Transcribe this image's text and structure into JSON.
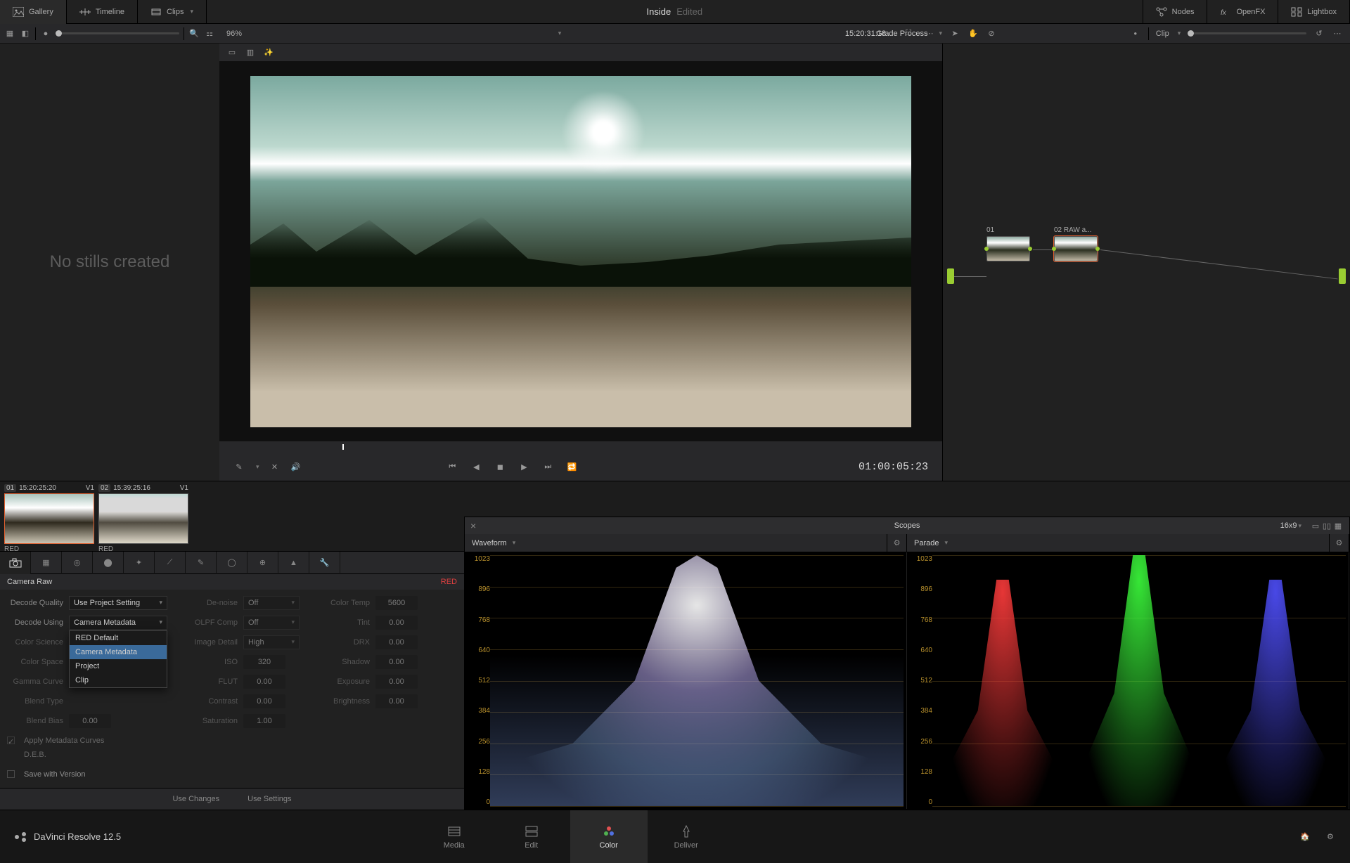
{
  "topbar": {
    "gallery": "Gallery",
    "timeline": "Timeline",
    "clips": "Clips",
    "title": "Inside",
    "subtitle": "Edited",
    "nodes": "Nodes",
    "openfx": "OpenFX",
    "lightbox": "Lightbox"
  },
  "toolbar2": {
    "zoom": "96%",
    "title": "Grade Process",
    "timecode": "15:20:31:18",
    "clip": "Clip"
  },
  "gallery": {
    "empty": "No stills created"
  },
  "viewer": {
    "timecode": "01:00:05:23"
  },
  "nodes": {
    "n1": "01",
    "n2": "02  RAW a..."
  },
  "clips": [
    {
      "num": "01",
      "tc": "15:20:25:20",
      "track": "V1",
      "codec": "RED"
    },
    {
      "num": "02",
      "tc": "15:39:25:16",
      "track": "V1",
      "codec": "RED"
    }
  ],
  "raw": {
    "title": "Camera Raw",
    "brand": "RED",
    "decodeQualityLabel": "Decode Quality",
    "decodeQuality": "Use Project Setting",
    "decodeUsingLabel": "Decode Using",
    "decodeUsing": "Camera Metadata",
    "dropdown": [
      "RED Default",
      "Camera Metadata",
      "Project",
      "Clip"
    ],
    "colorScienceLabel": "Color Science",
    "colorSpaceLabel": "Color Space",
    "gammaCurveLabel": "Gamma Curve",
    "blendTypeLabel": "Blend Type",
    "blendBiasLabel": "Blend Bias",
    "blendBias": "0.00",
    "applyMetaCurves": "Apply Metadata Curves",
    "deb": "D.E.B.",
    "saveVersion": "Save with Version",
    "denoiseLabel": "De-noise",
    "denoise": "Off",
    "olpfLabel": "OLPF Comp",
    "olpf": "Off",
    "imageDetailLabel": "Image Detail",
    "imageDetail": "High",
    "isoLabel": "ISO",
    "iso": "320",
    "flutLabel": "FLUT",
    "flut": "0.00",
    "contrastLabel": "Contrast",
    "contrast": "0.00",
    "saturationLabel": "Saturation",
    "saturation": "1.00",
    "colorTempLabel": "Color Temp",
    "colorTemp": "5600",
    "tintLabel": "Tint",
    "tint": "0.00",
    "drxLabel": "DRX",
    "drx": "0.00",
    "shadowLabel": "Shadow",
    "shadow": "0.00",
    "exposureLabel": "Exposure",
    "exposure": "0.00",
    "brightnessLabel": "Brightness",
    "brightness": "0.00",
    "useChanges": "Use Changes",
    "useSettings": "Use Settings"
  },
  "scopes": {
    "title": "Scopes",
    "aspect": "16x9",
    "waveform": "Waveform",
    "parade": "Parade",
    "axis": [
      "1023",
      "896",
      "768",
      "640",
      "512",
      "384",
      "256",
      "128",
      "0"
    ]
  },
  "pages": {
    "media": "Media",
    "edit": "Edit",
    "color": "Color",
    "deliver": "Deliver"
  },
  "app": {
    "name": "DaVinci Resolve 12.5"
  }
}
